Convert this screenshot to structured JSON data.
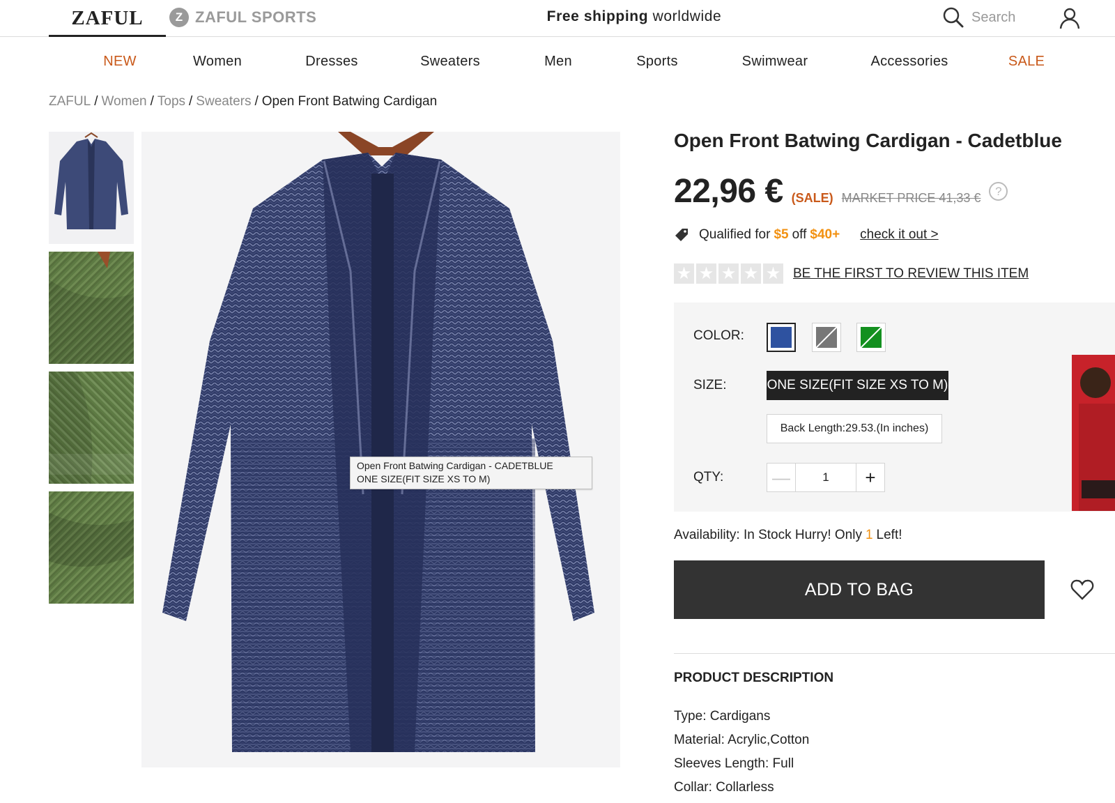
{
  "header": {
    "brand": "ZAFUL",
    "sports_badge": "Z",
    "sports_label": "ZAFUL SPORTS",
    "shipping_bold": "Free shipping",
    "shipping_rest": "worldwide",
    "search_label": "Search"
  },
  "nav": {
    "items": [
      "NEW",
      "Women",
      "Dresses",
      "Sweaters",
      "Men",
      "Sports",
      "Swimwear",
      "Accessories",
      "SALE"
    ],
    "accent_color": "#c9591a"
  },
  "breadcrumb": {
    "items": [
      "ZAFUL",
      "Women",
      "Tops",
      "Sweaters"
    ],
    "current": "Open Front Batwing Cardigan",
    "separator": "/"
  },
  "product": {
    "title": "Open Front Batwing Cardigan - Cadetblue",
    "price": "22,96 €",
    "sale_tag": "(SALE)",
    "market_price": "MARKET PRICE 41,33 €",
    "help_icon": "?",
    "promo": {
      "prefix": "Qualified for",
      "amount": "$5",
      "middle": "off",
      "threshold": "$40+",
      "link": "check it out >"
    },
    "rating": {
      "stars": 0,
      "max": 5,
      "review_link": "BE THE FIRST TO REVIEW THIS ITEM"
    },
    "tooltip": {
      "line1": "Open Front Batwing Cardigan - CADETBLUE",
      "line2": "ONE SIZE(FIT SIZE XS TO M)"
    }
  },
  "options": {
    "color_label": "COLOR:",
    "colors": [
      {
        "name": "cadetblue",
        "hex": "#2e52a0",
        "available": true,
        "selected": true
      },
      {
        "name": "gray",
        "hex": "#777777",
        "available": false,
        "selected": false
      },
      {
        "name": "green",
        "hex": "#13901f",
        "available": false,
        "selected": false
      }
    ],
    "size_label": "SIZE:",
    "size_value": "ONE SIZE(FIT SIZE XS TO M)",
    "back_length": "Back Length:29.53.(In inches)",
    "qty_label": "QTY:",
    "qty_value": "1",
    "qty_minus": "—",
    "qty_plus": "+"
  },
  "availability": {
    "prefix": "Availability: In Stock Hurry! Only",
    "count": "1",
    "suffix": "Left!"
  },
  "actions": {
    "add_to_bag": "ADD TO BAG"
  },
  "description": {
    "title": "PRODUCT DESCRIPTION",
    "lines": [
      "Type: Cardigans",
      "Material: Acrylic,Cotton",
      "Sleeves Length: Full",
      "Collar: Collarless"
    ]
  },
  "colors": {
    "accent_orange": "#c9591a",
    "highlight_yellow": "#f29111",
    "button_dark": "#333333"
  }
}
